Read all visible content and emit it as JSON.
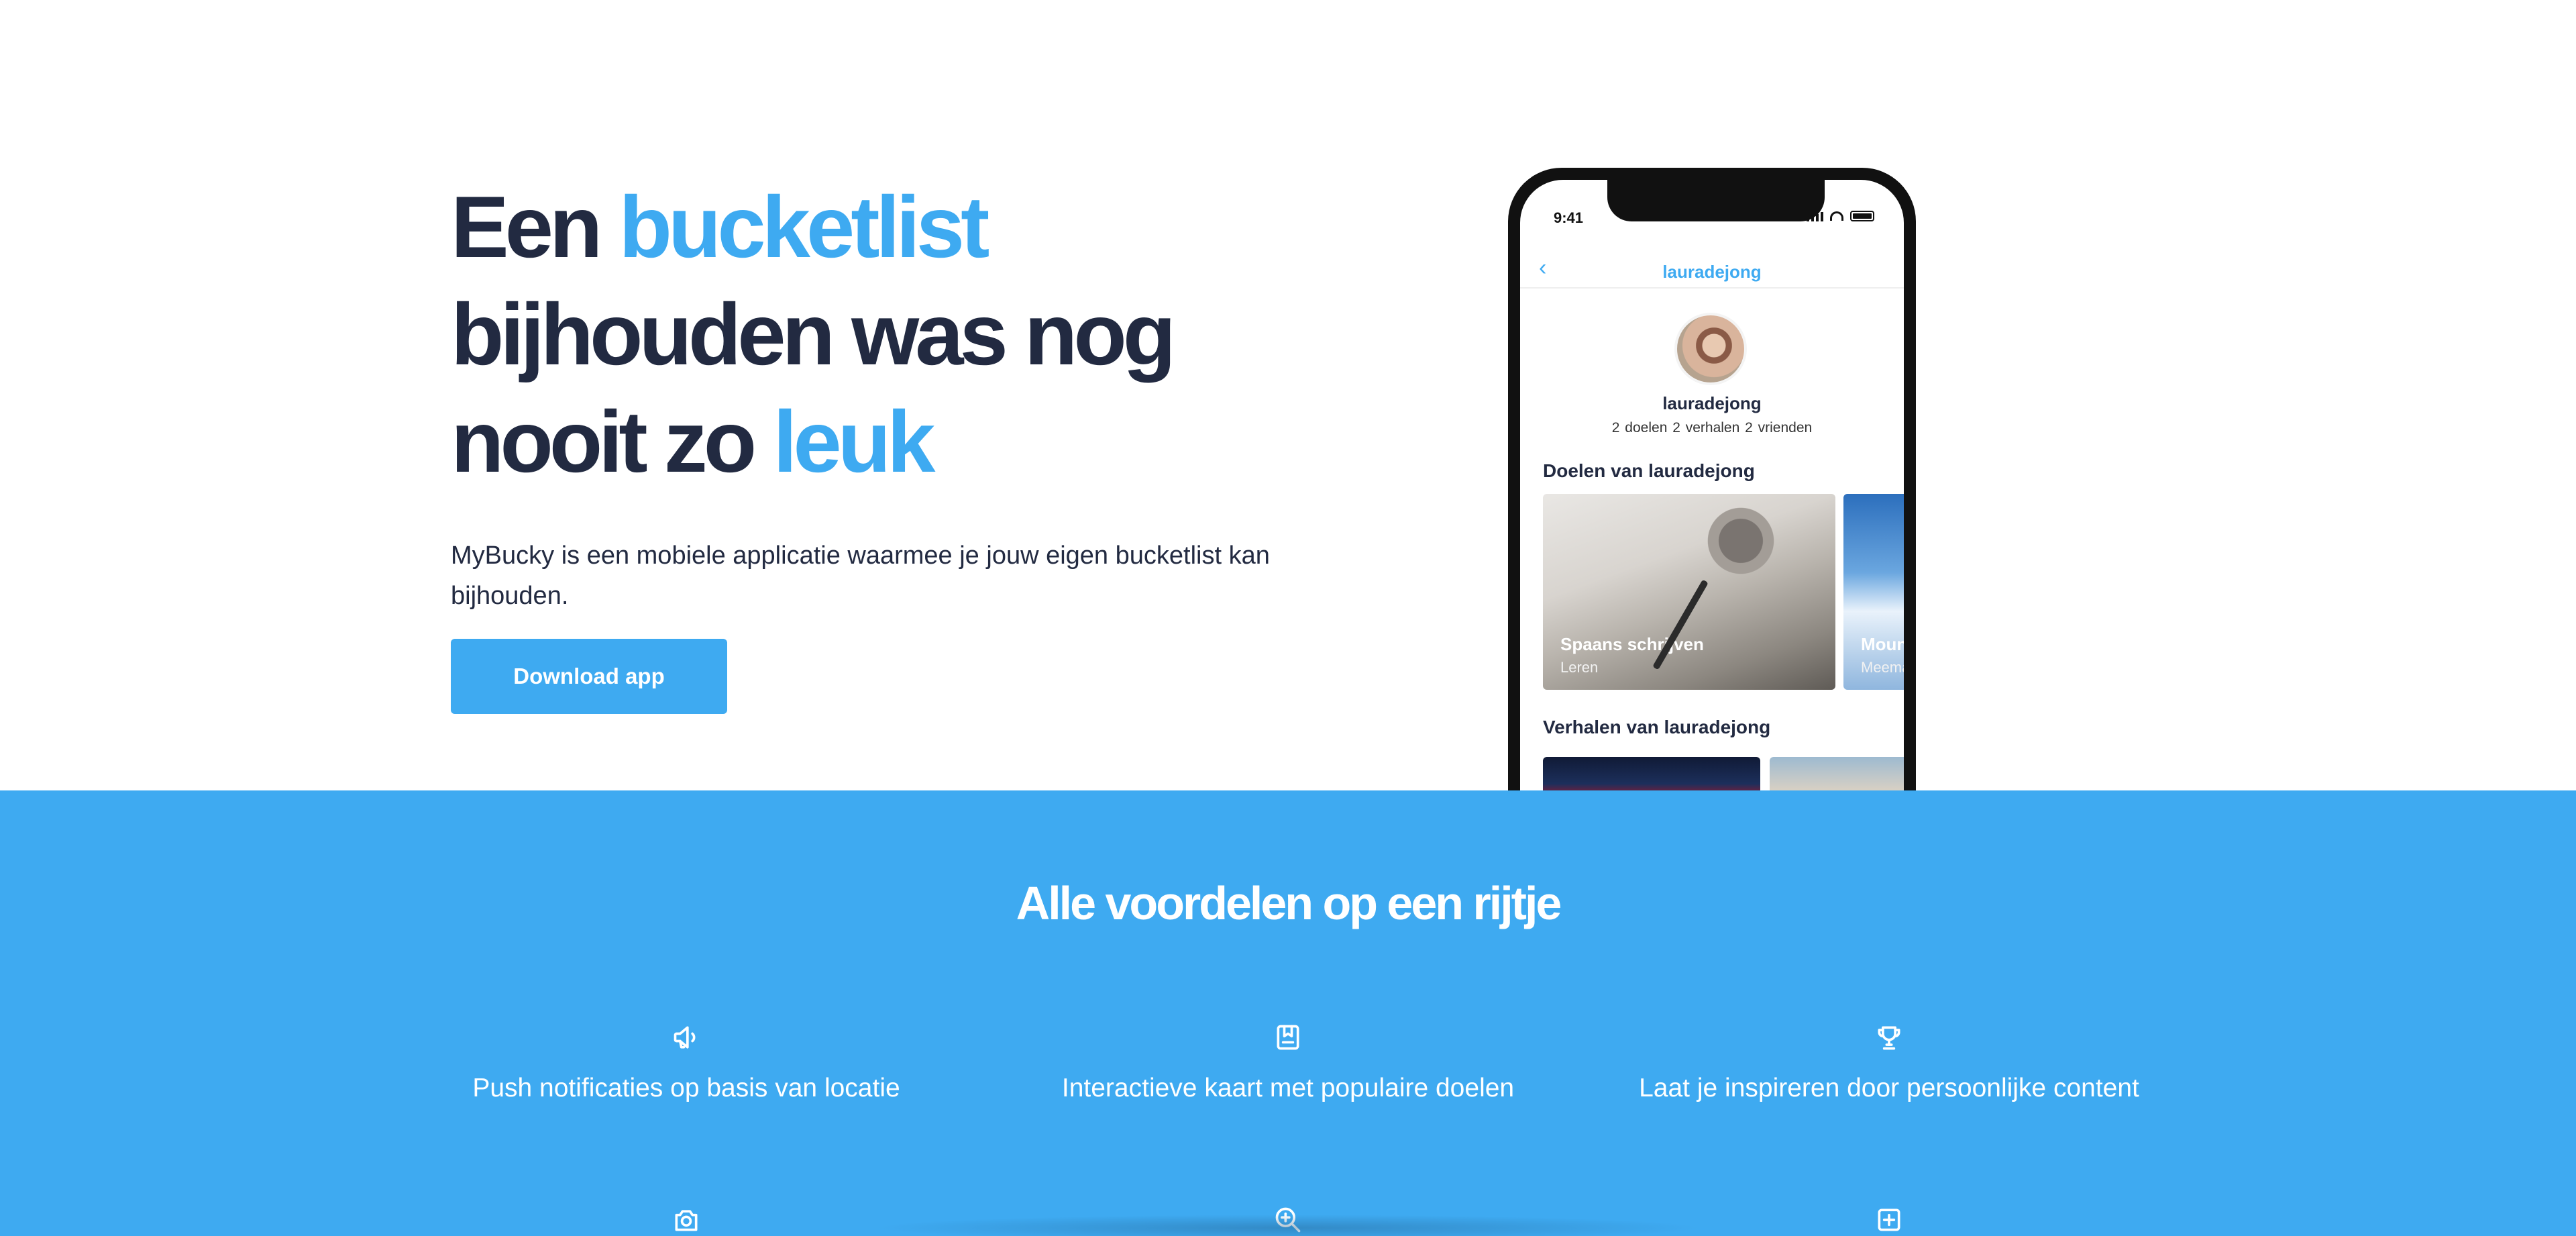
{
  "hero": {
    "headline_part1": "Een ",
    "headline_accent1": "bucketlist",
    "headline_part2": " bijhouden was nog nooit zo ",
    "headline_accent2": "leuk",
    "lead": "MyBucky is een mobiele applicatie waarmee je jouw eigen bucketlist kan bijhouden.",
    "cta_label": "Download app"
  },
  "phone": {
    "status_time": "9:41",
    "nav_title": "lauradejong",
    "profile_name": "lauradejong",
    "profile_stats": "2 doelen  2 verhalen  2 vrienden",
    "goals_heading": "Doelen van lauradejong",
    "goals": [
      {
        "title": "Spaans schrijven",
        "category": "Leren"
      },
      {
        "title": "Moun",
        "category": "Meema"
      }
    ],
    "stories_heading": "Verhalen van lauradejong"
  },
  "features": {
    "title": "Alle voordelen op een rijtje",
    "items": [
      {
        "icon": "megaphone-icon",
        "label": "Push notificaties op basis van locatie"
      },
      {
        "icon": "book-icon",
        "label": "Interactieve kaart met populaire doelen"
      },
      {
        "icon": "trophy-icon",
        "label": "Laat je inspireren door persoonlijke content"
      },
      {
        "icon": "camera-icon",
        "label": ""
      },
      {
        "icon": "zoom-in-icon",
        "label": ""
      },
      {
        "icon": "plus-square-icon",
        "label": ""
      }
    ]
  },
  "colors": {
    "accent": "#3eaaf1",
    "dark_text": "#222a41",
    "white": "#ffffff"
  }
}
